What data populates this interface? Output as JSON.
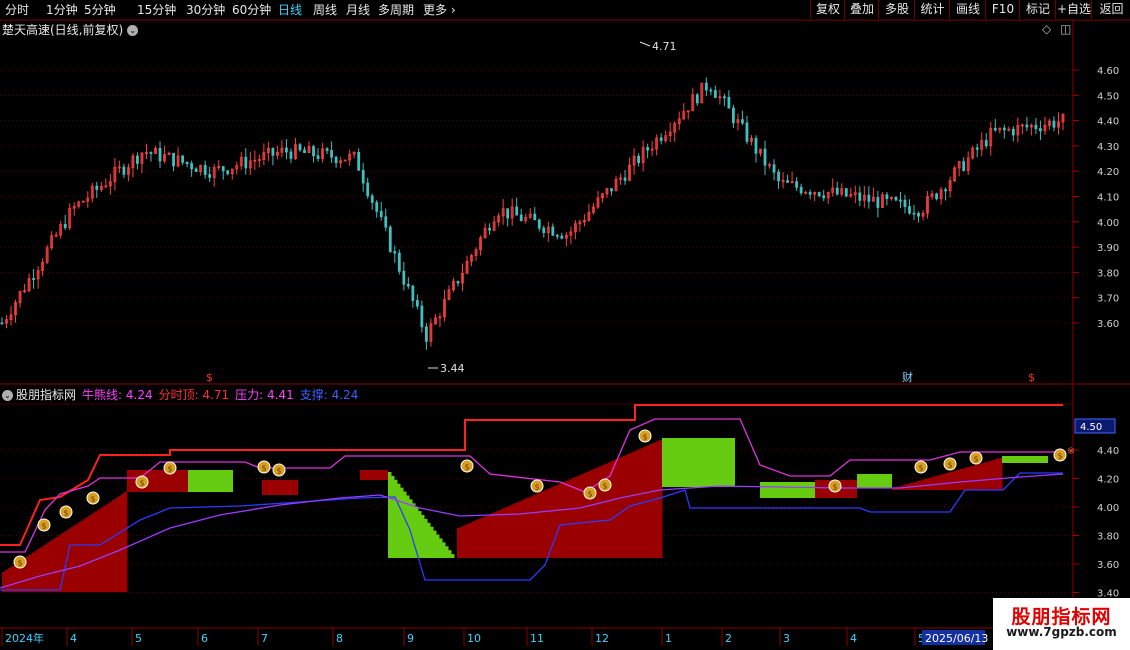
{
  "toolbar": {
    "periods": [
      {
        "label": "分时",
        "active": false
      },
      {
        "label": "1分钟",
        "active": false
      },
      {
        "label": "5分钟",
        "active": false
      },
      {
        "label": "15分钟",
        "active": false
      },
      {
        "label": "30分钟",
        "active": false
      },
      {
        "label": "60分钟",
        "active": false
      },
      {
        "label": "日线",
        "active": true
      },
      {
        "label": "周线",
        "active": false
      },
      {
        "label": "月线",
        "active": false
      },
      {
        "label": "多周期",
        "active": false
      },
      {
        "label": "更多",
        "active": false
      }
    ],
    "buttons": [
      "复权",
      "叠加",
      "多股",
      "统计",
      "画线",
      "F10",
      "标记",
      "+自选",
      "返回"
    ]
  },
  "main_chart": {
    "title": "楚天高速(日线,前复权)",
    "high_marker": "4.71",
    "low_marker": "3.44",
    "y_ticks": [
      "4.60",
      "4.50",
      "4.40",
      "4.30",
      "4.20",
      "4.10",
      "4.00",
      "3.90",
      "3.80",
      "3.70",
      "3.60"
    ],
    "event_markers": [
      "$",
      "财",
      "$"
    ]
  },
  "indicator": {
    "name": "股朋指标网",
    "items": [
      {
        "label": "牛熊线:",
        "value": "4.24",
        "color": "#ff40ff"
      },
      {
        "label": "分时顶:",
        "value": "4.71",
        "color": "#ff3030"
      },
      {
        "label": "压力:",
        "value": "4.41",
        "color": "#ff40ff"
      },
      {
        "label": "支撑:",
        "value": "4.24",
        "color": "#4060ff"
      }
    ],
    "y_ticks": [
      "4.40",
      "4.20",
      "4.00",
      "3.80",
      "3.60",
      "3.40"
    ],
    "current_value": "4.50",
    "colors": {
      "up": "#ff4040",
      "down": "#40c0c0",
      "red_fill": "#9a0000",
      "green_fill": "#66cc11",
      "line_red": "#ff2020",
      "line_magenta": "#dd33dd",
      "line_blue": "#2b3bff",
      "line_purple": "#9a3cff",
      "coin": "#d9a020"
    }
  },
  "x_axis": {
    "labels": [
      "2024年",
      "4",
      "5",
      "6",
      "7",
      "8",
      "9",
      "10",
      "11",
      "12",
      "1",
      "2",
      "3",
      "4",
      "5"
    ],
    "cursor_date": "2025/06/13"
  },
  "watermark": {
    "name": "股朋指标网",
    "url": "www.7gpzb.com"
  },
  "chart_data": {
    "type": "line",
    "title": "楚天高速(日线,前复权)",
    "x": [
      "2024-03",
      "2024-04",
      "2024-05",
      "2024-06",
      "2024-07",
      "2024-08",
      "2024-09",
      "2024-10",
      "2024-11",
      "2024-12",
      "2025-01",
      "2025-02",
      "2025-03",
      "2025-04",
      "2025-05",
      "2025-06"
    ],
    "series": [
      {
        "name": "close",
        "values": [
          3.6,
          4.05,
          4.28,
          4.2,
          4.28,
          4.25,
          3.55,
          4.05,
          3.95,
          4.25,
          4.55,
          4.15,
          4.1,
          4.05,
          4.35,
          4.4
        ]
      }
    ],
    "ylim": [
      3.4,
      4.75
    ]
  }
}
